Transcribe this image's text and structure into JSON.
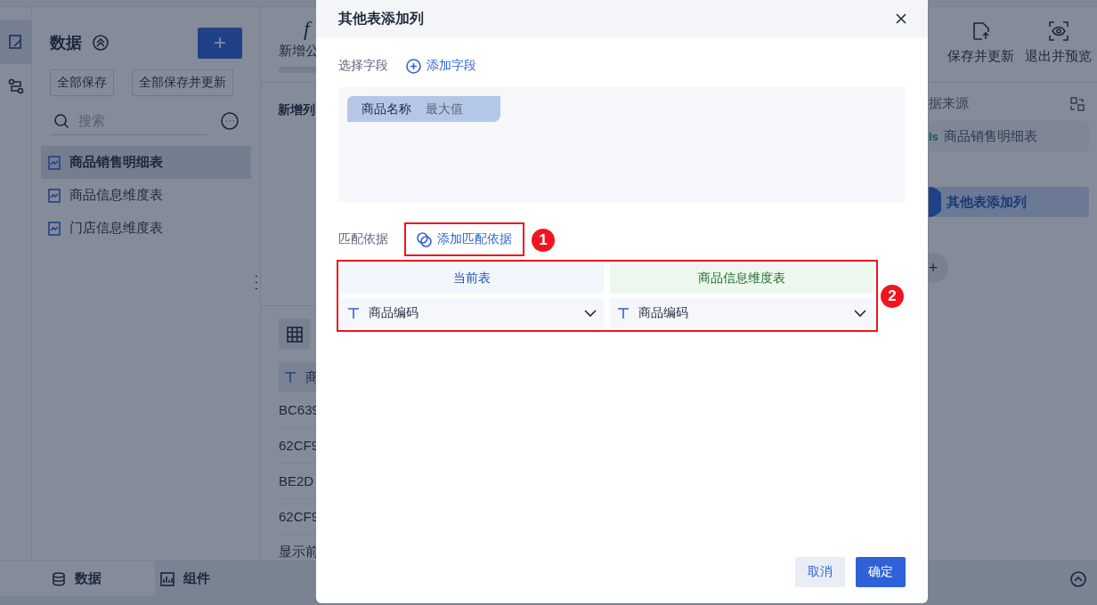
{
  "rail": [
    {
      "kind": "edit",
      "selected": true
    },
    {
      "kind": "flow",
      "selected": false
    }
  ],
  "data_panel": {
    "title": "数据",
    "add_button": "+",
    "buttons": [
      "全部保存",
      "全部保存并更新"
    ],
    "search": {
      "placeholder": "搜索"
    },
    "tables": [
      {
        "label": "商品销售明细表",
        "selected": true
      },
      {
        "label": "商品信息维度表",
        "selected": false
      },
      {
        "label": "门店信息维度表",
        "selected": false
      }
    ]
  },
  "editor": {
    "tool_icon": "f",
    "tool_label": "新增公",
    "section_title": "新增列",
    "column_1": "商",
    "rows": [
      "BC639",
      "62CF9",
      "BE2D",
      "62CF9"
    ],
    "footer": "显示前"
  },
  "right_panel": {
    "actions": [
      {
        "kind": "save",
        "label": "保存并更新"
      },
      {
        "kind": "preview",
        "label": "退出并预览"
      }
    ],
    "source_title": "据来源",
    "steps": [
      {
        "kind": "source",
        "badge": "ls",
        "label": "商品销售明细表",
        "selected": false
      },
      {
        "kind": "join",
        "label": "其他表添加列",
        "selected": true
      },
      {
        "kind": "add",
        "label": "+"
      }
    ]
  },
  "bottom_tabs": [
    {
      "kind": "data",
      "label": "数据",
      "selected": true
    },
    {
      "kind": "widget",
      "label": "组件",
      "selected": false
    }
  ],
  "dialog": {
    "title": "其他表添加列",
    "field_label": "选择字段",
    "add_field": "添加字段",
    "fields": [
      {
        "name": "商品名称",
        "aggregate": "最大值"
      }
    ],
    "match_label": "匹配依据",
    "add_match": {
      "label": "添加匹配依据",
      "annotation": "1"
    },
    "match_table": {
      "annotation": "2",
      "columns": [
        {
          "kind": "current",
          "label": "当前表"
        },
        {
          "kind": "other",
          "label": "商品信息维度表"
        }
      ],
      "rows": [
        [
          "商品编码",
          "商品编码"
        ]
      ]
    },
    "buttons": [
      {
        "kind": "secondary",
        "label": "取消"
      },
      {
        "kind": "primary",
        "label": "确定"
      }
    ]
  }
}
